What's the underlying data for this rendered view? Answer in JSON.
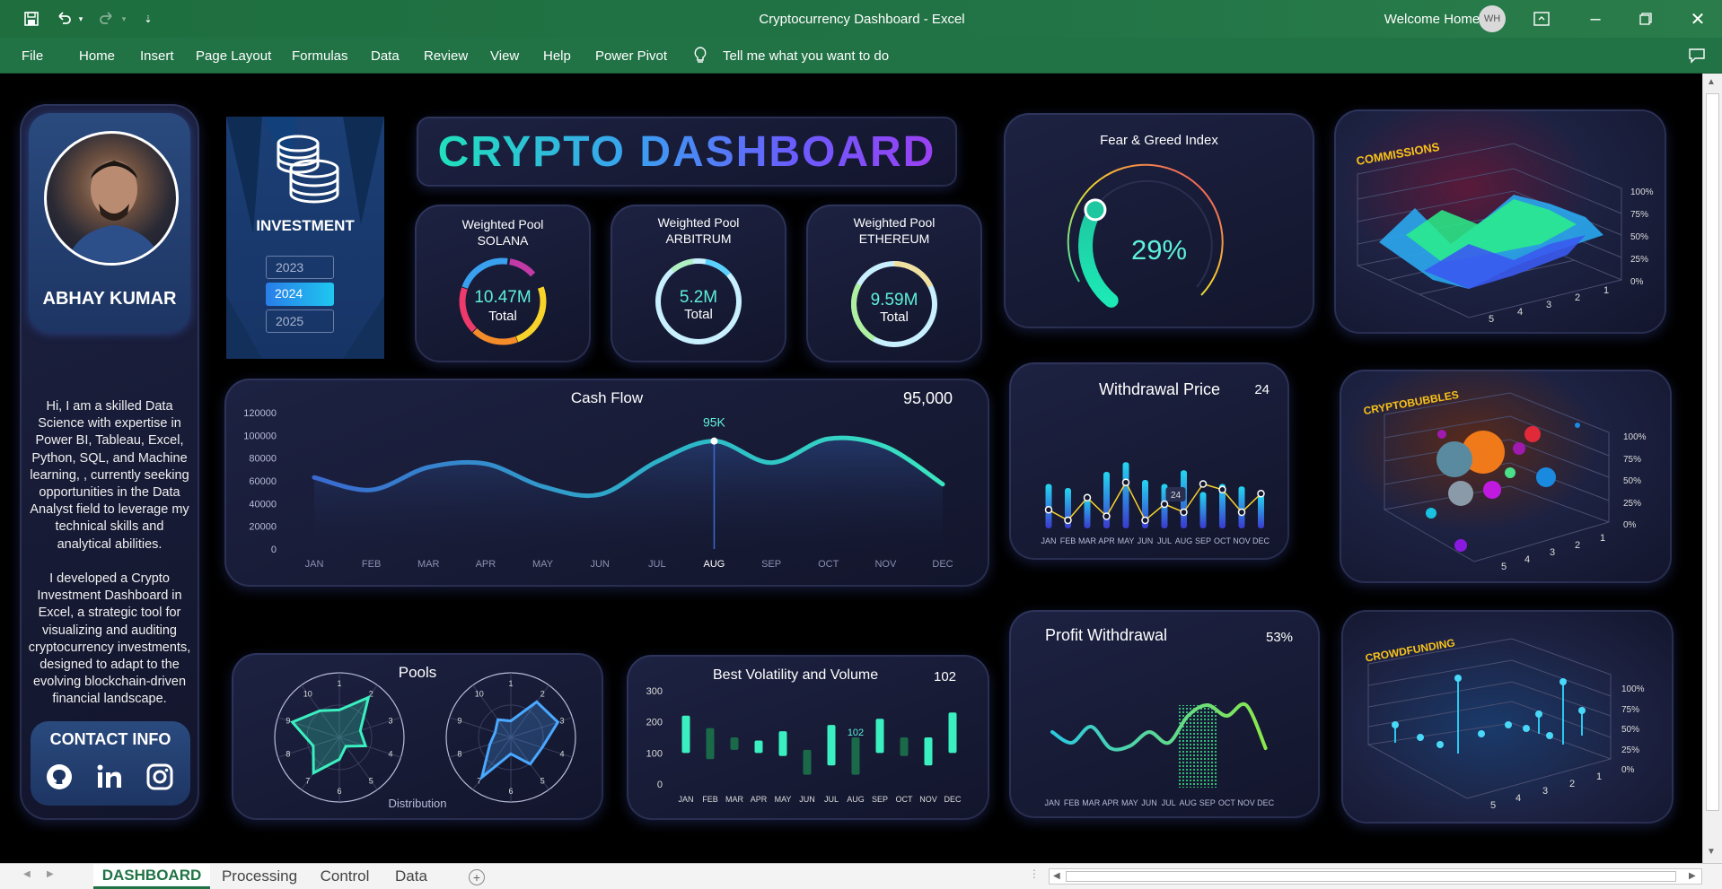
{
  "window": {
    "title": "Cryptocurrency Dashboard  -  Excel",
    "user": "Welcome Home",
    "initials": "WH"
  },
  "ribbon": {
    "tabs": [
      "File",
      "Home",
      "Insert",
      "Page Layout",
      "Formulas",
      "Data",
      "Review",
      "View",
      "Help",
      "Power Pivot"
    ],
    "tell_me": "Tell me what you want to do"
  },
  "profile": {
    "name": "ABHAY KUMAR",
    "bio1": "Hi, I am a skilled Data Science with expertise in Power BI, Tableau, Excel, Python, SQL, and Machine learning, , currently seeking opportunities in the Data Analyst field to leverage my technical skills and analytical abilities.",
    "bio2": "I developed a Crypto Investment Dashboard in Excel, a strategic tool for visualizing and auditing cryptocurrency investments, designed to adapt to the evolving blockchain-driven financial landscape.",
    "contact": "CONTACT INFO"
  },
  "investment": {
    "label": "INVESTMENT",
    "years": [
      "2023",
      "2024",
      "2025"
    ],
    "selected": "2024"
  },
  "header": {
    "title": "CRYPTO DASHBOARD"
  },
  "pools": [
    {
      "l1": "Weighted Pool",
      "l2": "SOLANA",
      "value": "10.47M",
      "sub": "Total"
    },
    {
      "l1": "Weighted Pool",
      "l2": "ARBITRUM",
      "value": "5.2M",
      "sub": "Total"
    },
    {
      "l1": "Weighted Pool",
      "l2": "ETHEREUM",
      "value": "9.59M",
      "sub": "Total"
    }
  ],
  "fear_greed": {
    "title": "Fear & Greed Index",
    "value": "29%",
    "level": 0.29
  },
  "cashflow": {
    "title": "Cash Flow",
    "total": "95,000",
    "marker": "95K",
    "highlight": "AUG"
  },
  "withdrawal": {
    "title": "Withdrawal Price",
    "value": "24",
    "point_label": "24"
  },
  "profit": {
    "title": "Profit Withdrawal",
    "value": "53%"
  },
  "pools_radar": {
    "title": "Pools",
    "subtitle": "Distribution",
    "ticks": [
      "1",
      "2",
      "3",
      "4",
      "5",
      "6",
      "7",
      "8",
      "9",
      "10"
    ]
  },
  "volatility": {
    "title": "Best Volatility and Volume",
    "value": "102",
    "marker": "102"
  },
  "charts3d": [
    {
      "title": "COMMISSIONS",
      "ylabels": [
        "100%",
        "75%",
        "50%",
        "25%",
        "0%"
      ],
      "xlabels": [
        "5",
        "4",
        "3",
        "2",
        "1"
      ]
    },
    {
      "title": "CRYPTOBUBBLES",
      "ylabels": [
        "100%",
        "75%",
        "50%",
        "25%",
        "0%"
      ],
      "xlabels": [
        "5",
        "4",
        "3",
        "2",
        "1"
      ]
    },
    {
      "title": "CROWDFUNDING",
      "ylabels": [
        "100%",
        "75%",
        "50%",
        "25%",
        "0%"
      ],
      "xlabels": [
        "5",
        "4",
        "3",
        "2",
        "1"
      ]
    }
  ],
  "sheet_tabs": [
    "DASHBOARD",
    "Processing",
    "Control",
    "Data"
  ],
  "chart_data": [
    {
      "type": "area",
      "title": "Cash Flow",
      "categories": [
        "JAN",
        "FEB",
        "MAR",
        "APR",
        "MAY",
        "JUN",
        "JUL",
        "AUG",
        "SEP",
        "OCT",
        "NOV",
        "DEC"
      ],
      "values": [
        63000,
        52000,
        72000,
        75000,
        55000,
        48000,
        77000,
        95000,
        76000,
        97000,
        90000,
        57000
      ],
      "ylim": [
        0,
        120000
      ],
      "yticks": [
        "120000",
        "100000",
        "80000",
        "60000",
        "40000",
        "20000",
        "0"
      ]
    },
    {
      "type": "bar",
      "title": "Withdrawal Price",
      "categories": [
        "JAN",
        "FEB",
        "MAR",
        "APR",
        "MAY",
        "JUN",
        "JUL",
        "AUG",
        "SEP",
        "OCT",
        "NOV",
        "DEC"
      ],
      "series": [
        {
          "values": [
            55,
            50,
            40,
            70,
            82,
            60,
            55,
            72,
            45,
            55,
            52,
            42
          ]
        },
        {
          "values": [
            23,
            10,
            38,
            15,
            57,
            10,
            30,
            20,
            55,
            48,
            20,
            43
          ]
        }
      ],
      "ylim": [
        0,
        100
      ]
    },
    {
      "type": "line",
      "title": "Profit Withdrawal",
      "categories": [
        "JAN",
        "FEB",
        "MAR",
        "APR",
        "MAY",
        "JUN",
        "JUL",
        "AUG",
        "SEP",
        "OCT",
        "NOV",
        "DEC"
      ],
      "values": [
        55,
        45,
        60,
        40,
        42,
        55,
        45,
        70,
        80,
        70,
        80,
        40
      ],
      "ylim": [
        0,
        100
      ]
    },
    {
      "type": "bar",
      "title": "Best Volatility and Volume",
      "categories": [
        "JAN",
        "FEB",
        "MAR",
        "APR",
        "MAY",
        "JUN",
        "JUL",
        "AUG",
        "SEP",
        "OCT",
        "NOV",
        "DEC"
      ],
      "lows": [
        100,
        80,
        110,
        100,
        90,
        30,
        60,
        30,
        100,
        90,
        60,
        100
      ],
      "highs": [
        220,
        180,
        150,
        140,
        170,
        110,
        190,
        150,
        210,
        150,
        150,
        230
      ],
      "ylim": [
        0,
        300
      ],
      "yticks": [
        "300",
        "200",
        "100",
        "0"
      ]
    }
  ]
}
